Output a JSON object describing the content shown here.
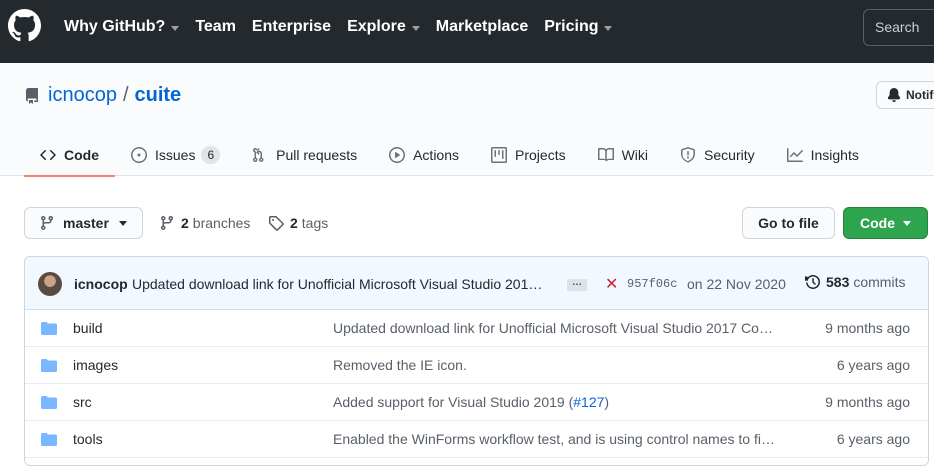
{
  "header": {
    "nav": [
      {
        "label": "Why GitHub?",
        "dropdown": true
      },
      {
        "label": "Team",
        "dropdown": false
      },
      {
        "label": "Enterprise",
        "dropdown": false
      },
      {
        "label": "Explore",
        "dropdown": true
      },
      {
        "label": "Marketplace",
        "dropdown": false
      },
      {
        "label": "Pricing",
        "dropdown": true
      }
    ],
    "search_label": "Search"
  },
  "repo": {
    "owner": "icnocop",
    "separator": "/",
    "name": "cuite",
    "notifications_label": "Notif"
  },
  "tabs": [
    {
      "label": "Code",
      "icon": "code-icon",
      "active": true
    },
    {
      "label": "Issues",
      "icon": "issue-opened-icon",
      "count": "6"
    },
    {
      "label": "Pull requests",
      "icon": "git-pull-request-icon"
    },
    {
      "label": "Actions",
      "icon": "play-icon"
    },
    {
      "label": "Projects",
      "icon": "project-icon"
    },
    {
      "label": "Wiki",
      "icon": "book-icon"
    },
    {
      "label": "Security",
      "icon": "shield-icon"
    },
    {
      "label": "Insights",
      "icon": "graph-icon"
    }
  ],
  "controls": {
    "branch": "master",
    "branches_count": "2",
    "branches_label": "branches",
    "tags_count": "2",
    "tags_label": "tags",
    "goto_file": "Go to file",
    "code": "Code"
  },
  "latest_commit": {
    "author": "icnocop",
    "message": "Updated download link for Unofficial Microsoft Visual Studio 201…",
    "ellipsis": "…",
    "status": "✕",
    "sha": "957f06c",
    "date": "on 22 Nov 2020",
    "commits_count": "583",
    "commits_label": "commits"
  },
  "files": [
    {
      "name": "build",
      "message": "Updated download link for Unofficial Microsoft Visual Studio 2017 Co…",
      "age": "9 months ago"
    },
    {
      "name": "images",
      "message": "Removed the IE icon.",
      "age": "6 years ago"
    },
    {
      "name": "src",
      "message_prefix": "Added support for Visual Studio 2019 (",
      "message_link": "#127",
      "message_suffix": ")",
      "age": "9 months ago"
    },
    {
      "name": "tools",
      "message": "Enabled the WinForms workflow test, and is using control names to fi…",
      "age": "6 years ago"
    }
  ],
  "colors": {
    "header_bg": "#24292e",
    "link": "#0366d6",
    "tab_underline": "#f9826c",
    "primary_button": "#2ea44f",
    "commit_bar": "#f1f8ff",
    "folder": "#79b8ff",
    "status_fail": "#cb2431"
  }
}
